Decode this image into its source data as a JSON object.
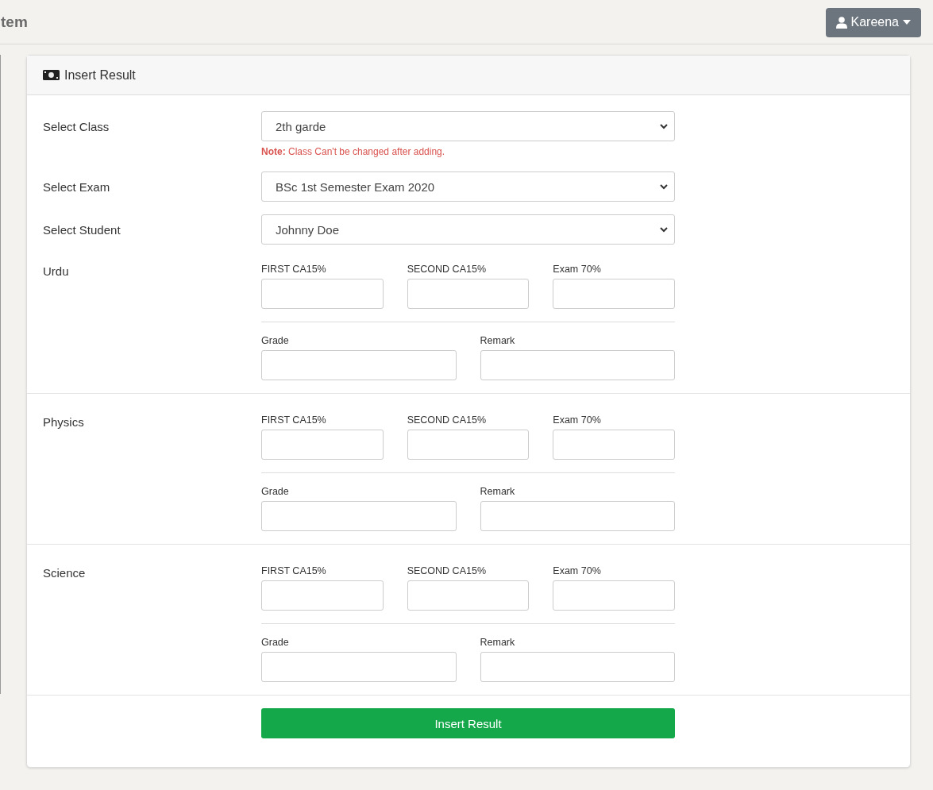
{
  "topbar": {
    "title_fragment": "tem",
    "user_button": {
      "label": "Kareena"
    }
  },
  "card": {
    "title": "Insert Result",
    "selects": [
      {
        "label": "Select Class",
        "value": "2th garde",
        "note": {
          "strong": "Note:",
          "text": "Class Can't be changed after adding."
        }
      },
      {
        "label": "Select Exam",
        "value": "BSc 1st Semester Exam 2020"
      },
      {
        "label": "Select Student",
        "value": "Johnny Doe"
      }
    ],
    "subjects": [
      {
        "name": "Urdu",
        "score_fields": [
          "FIRST CA15%",
          "SECOND CA15%",
          "Exam 70%"
        ],
        "text_fields": [
          "Grade",
          "Remark"
        ]
      },
      {
        "name": "Physics",
        "score_fields": [
          "FIRST CA15%",
          "SECOND CA15%",
          "Exam 70%"
        ],
        "text_fields": [
          "Grade",
          "Remark"
        ]
      },
      {
        "name": "Science",
        "score_fields": [
          "FIRST CA15%",
          "SECOND CA15%",
          "Exam 70%"
        ],
        "text_fields": [
          "Grade",
          "Remark"
        ]
      }
    ],
    "submit_button": "Insert Result"
  }
}
